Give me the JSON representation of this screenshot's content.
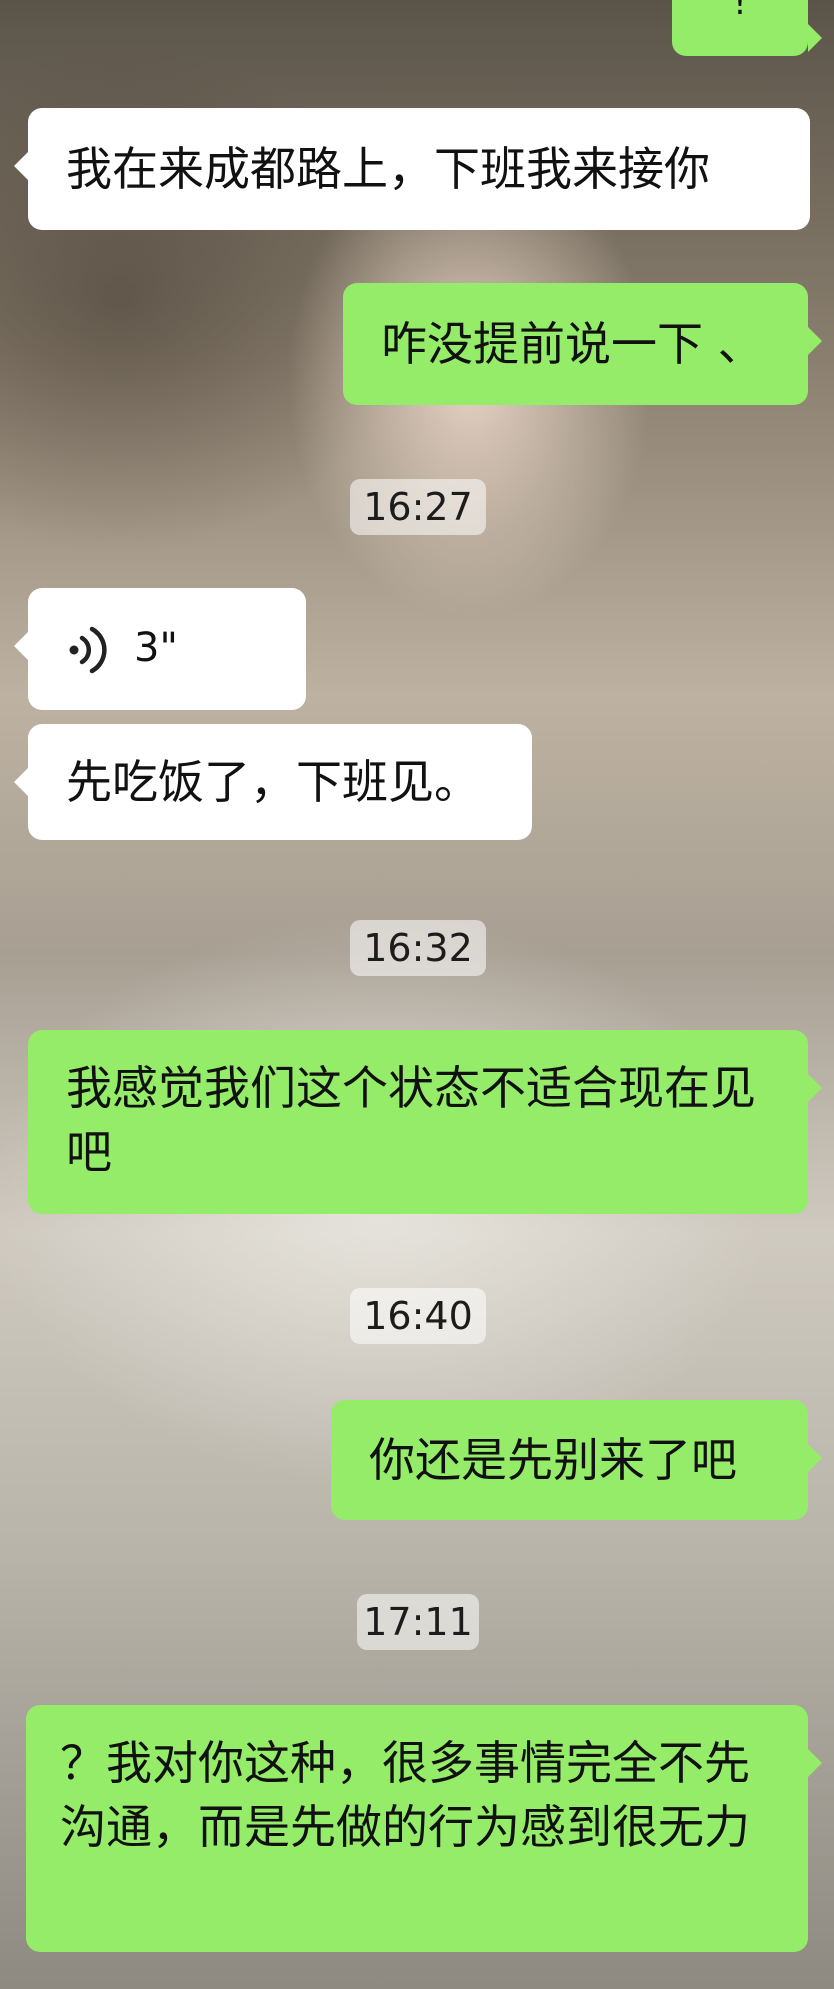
{
  "colors": {
    "green_bubble": "#95ec69",
    "white_bubble": "#ffffff",
    "timestamp_bg": "rgba(255,255,255,0.55)"
  },
  "top_partial_bubble": {
    "text": "!"
  },
  "messages": [
    {
      "side": "left",
      "type": "text",
      "text": "我在来成都路上，下班我来接你"
    },
    {
      "side": "right",
      "type": "text",
      "text": "咋没提前说一下 、"
    },
    {
      "type": "time",
      "text": "16:27"
    },
    {
      "side": "left",
      "type": "voice",
      "icon": "voice-icon",
      "duration": "3\""
    },
    {
      "side": "left",
      "type": "text",
      "text": "先吃饭了，下班见。"
    },
    {
      "type": "time",
      "text": "16:32"
    },
    {
      "side": "right",
      "type": "text",
      "text": "我感觉我们这个状态不适合现在见吧"
    },
    {
      "type": "time",
      "text": "16:40"
    },
    {
      "side": "right",
      "type": "text",
      "text": "你还是先别来了吧"
    },
    {
      "type": "time",
      "text": "17:11"
    },
    {
      "side": "right",
      "type": "text",
      "text": "？我对你这种，很多事情完全不先沟通，而是先做的行为感到很无力"
    }
  ]
}
